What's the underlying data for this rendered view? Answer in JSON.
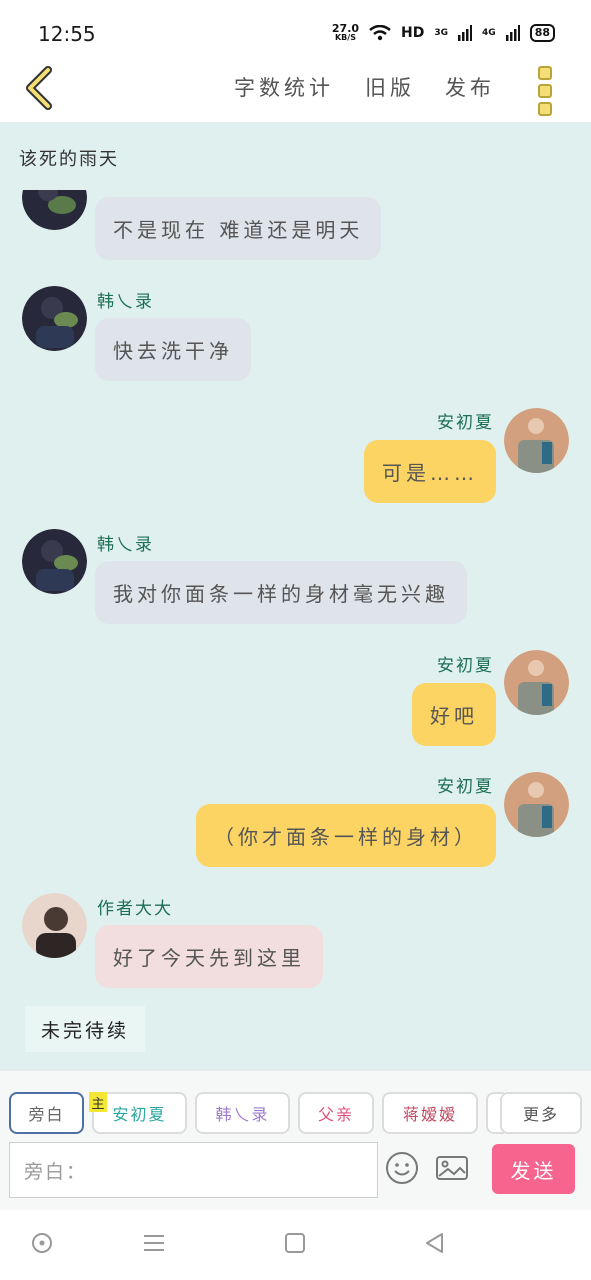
{
  "status_bar": {
    "time": "12:55",
    "net_speed_value": "27.0",
    "net_speed_unit": "KB/S",
    "hd": "HD",
    "sim1": "3G",
    "sim2": "4G",
    "battery": "88"
  },
  "nav": {
    "word_count": "字数统计",
    "old_version": "旧版",
    "publish": "发布"
  },
  "chat": {
    "title": "该死的雨天",
    "messages": [
      {
        "speaker": "",
        "text": "不是现在 难道还是明天"
      },
      {
        "speaker": "韩乀录",
        "text": "快去洗干净"
      },
      {
        "speaker": "安初夏",
        "text": "可是……"
      },
      {
        "speaker": "韩乀录",
        "text": "我对你面条一样的身材毫无兴趣"
      },
      {
        "speaker": "安初夏",
        "text": "好吧"
      },
      {
        "speaker": "安初夏",
        "text": "（你才面条一样的身材）"
      },
      {
        "speaker": "作者大大",
        "text": "好了今天先到这里"
      }
    ],
    "to_be_continued": "未完待续"
  },
  "composer": {
    "characters": [
      "旁白",
      "安初夏",
      "韩乀录",
      "父亲",
      "蒋嫒嫒",
      "更多"
    ],
    "host_tag": "主",
    "input_placeholder": "旁白：",
    "send_label": "发送"
  },
  "colors": {
    "chat_bg": "#dff0ef",
    "gray_bubble": "#dfe3ea",
    "yellow_bubble": "#fbd464",
    "pink_bubble": "#f2dede",
    "send_button": "#f7658e",
    "name_color": "#1f6f54"
  }
}
